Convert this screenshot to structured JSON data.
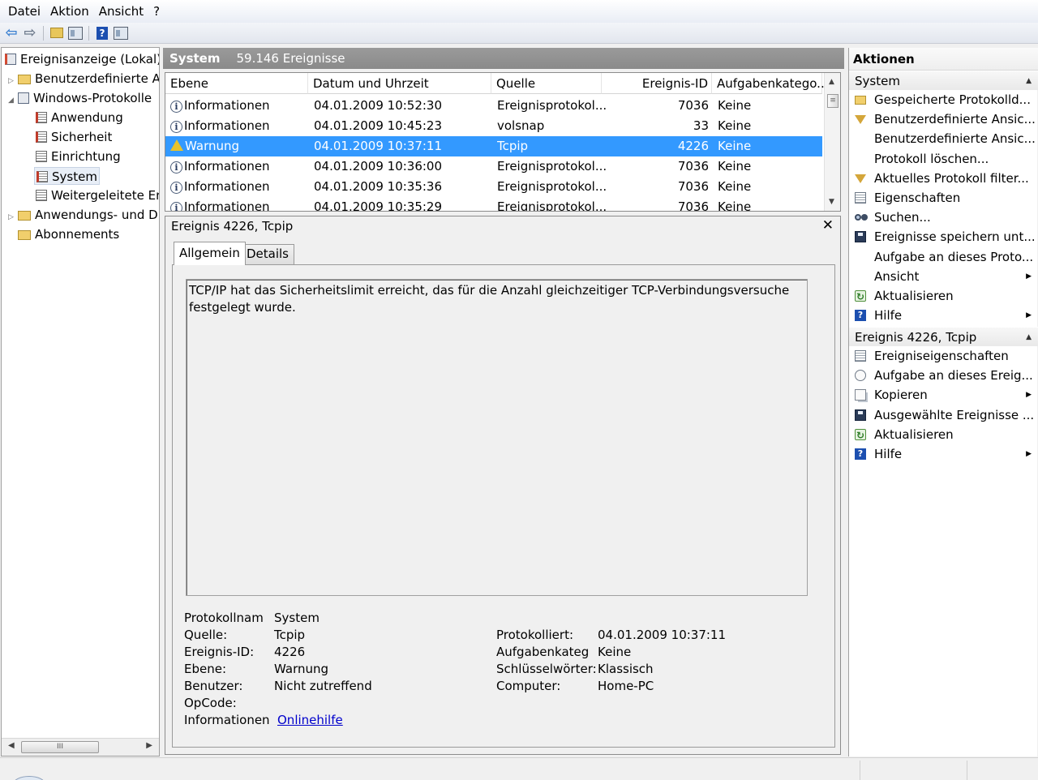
{
  "menu": [
    "Datei",
    "Aktion",
    "Ansicht",
    "?"
  ],
  "toolbar": {
    "icons": [
      "back-arrow-icon",
      "forward-arrow-icon",
      "folder-up-icon",
      "console-tree-icon",
      "help-icon",
      "action-pane-icon"
    ]
  },
  "tree": {
    "root": "Ereignisanzeige (Lokal)",
    "custom_views": "Benutzerdefinierte An",
    "windows_logs": "Windows-Protokolle",
    "application": "Anwendung",
    "security": "Sicherheit",
    "setup": "Einrichtung",
    "system": "System",
    "forwarded": "Weitergeleitete Ere",
    "apps_services": "Anwendungs- und Die",
    "subscriptions": "Abonnements",
    "scroll_grip": "III"
  },
  "center_header": {
    "log": "System",
    "count": "59.146 Ereignisse"
  },
  "columns": [
    "Ebene",
    "Datum und Uhrzeit",
    "Quelle",
    "Ereignis-ID",
    "Aufgabenkatego..."
  ],
  "events": [
    {
      "level": "Informationen",
      "date": "04.01.2009 10:52:30",
      "source": "Ereignisprotokol...",
      "id": "7036",
      "task": "Keine",
      "type": "info",
      "selected": false
    },
    {
      "level": "Informationen",
      "date": "04.01.2009 10:45:23",
      "source": "volsnap",
      "id": "33",
      "task": "Keine",
      "type": "info",
      "selected": false
    },
    {
      "level": "Warnung",
      "date": "04.01.2009 10:37:11",
      "source": "Tcpip",
      "id": "4226",
      "task": "Keine",
      "type": "warning",
      "selected": true
    },
    {
      "level": "Informationen",
      "date": "04.01.2009 10:36:00",
      "source": "Ereignisprotokol...",
      "id": "7036",
      "task": "Keine",
      "type": "info",
      "selected": false
    },
    {
      "level": "Informationen",
      "date": "04.01.2009 10:35:36",
      "source": "Ereignisprotokol...",
      "id": "7036",
      "task": "Keine",
      "type": "info",
      "selected": false
    },
    {
      "level": "Informationen",
      "date": "04.01.2009 10:35:29",
      "source": "Ereignisprotokol...",
      "id": "7036",
      "task": "Keine",
      "type": "info",
      "selected": false
    }
  ],
  "detail": {
    "title": "Ereignis 4226, Tcpip",
    "close": "✕",
    "tabs": [
      "Allgemein",
      "Details"
    ],
    "description": "TCP/IP hat das Sicherheitslimit erreicht, das für die Anzahl gleichzeitiger TCP-Verbindungsversuche festgelegt wurde.",
    "fields": {
      "log_name_label": "Protokollnam",
      "log_name": "System",
      "source_label": "Quelle:",
      "source": "Tcpip",
      "event_id_label": "Ereignis-ID:",
      "event_id": "4226",
      "level_label": "Ebene:",
      "level": "Warnung",
      "user_label": "Benutzer:",
      "user": "Nicht zutreffend",
      "opcode_label": "OpCode:",
      "info_label": "Informationen",
      "info_link": "Onlinehilfe",
      "logged_label": "Protokolliert:",
      "logged": "04.01.2009 10:37:11",
      "task_label": "Aufgabenkateg",
      "task": "Keine",
      "keywords_label": "Schlüsselwörter:",
      "keywords": "Klassisch",
      "computer_label": "Computer:",
      "computer": "Home-PC"
    }
  },
  "actions": {
    "title": "Aktionen",
    "section1": "System",
    "items1": [
      {
        "label": "Gespeicherte Protokolld...",
        "icon": "folder-open-icon",
        "submenu": false
      },
      {
        "label": "Benutzerdefinierte Ansic...",
        "icon": "filter-icon",
        "submenu": false
      },
      {
        "label": "Benutzerdefinierte Ansic...",
        "icon": "",
        "submenu": false
      },
      {
        "label": "Protokoll löschen...",
        "icon": "",
        "submenu": false
      },
      {
        "label": "Aktuelles Protokoll filter...",
        "icon": "filter-icon",
        "submenu": false
      },
      {
        "label": "Eigenschaften",
        "icon": "properties-icon",
        "submenu": false
      },
      {
        "label": "Suchen...",
        "icon": "binoculars-icon",
        "submenu": false
      },
      {
        "label": "Ereignisse speichern unt...",
        "icon": "save-icon",
        "submenu": false
      },
      {
        "label": "Aufgabe an dieses Proto...",
        "icon": "",
        "submenu": false
      },
      {
        "label": "Ansicht",
        "icon": "",
        "submenu": true
      },
      {
        "label": "Aktualisieren",
        "icon": "refresh-icon",
        "submenu": false
      },
      {
        "label": "Hilfe",
        "icon": "help-icon",
        "submenu": true
      }
    ],
    "section2": "Ereignis 4226, Tcpip",
    "items2": [
      {
        "label": "Ereigniseigenschaften",
        "icon": "properties-icon",
        "submenu": false
      },
      {
        "label": "Aufgabe an dieses Ereig...",
        "icon": "task-icon",
        "submenu": false
      },
      {
        "label": "Kopieren",
        "icon": "copy-icon",
        "submenu": true
      },
      {
        "label": "Ausgewählte Ereignisse ...",
        "icon": "save-icon",
        "submenu": false
      },
      {
        "label": "Aktualisieren",
        "icon": "refresh-icon",
        "submenu": false
      },
      {
        "label": "Hilfe",
        "icon": "help-icon",
        "submenu": true
      }
    ]
  }
}
